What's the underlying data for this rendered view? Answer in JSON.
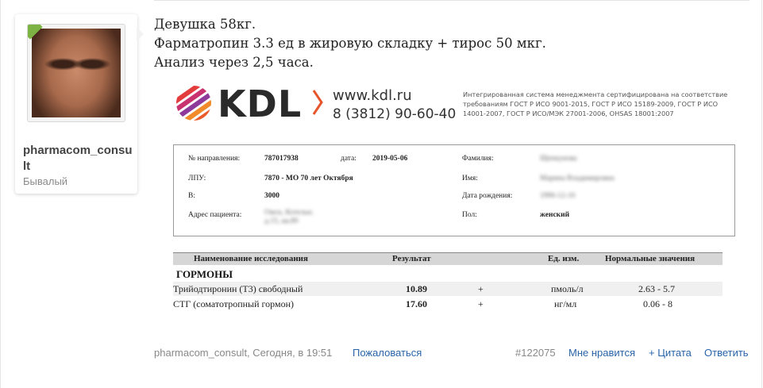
{
  "author": {
    "name": "pharmacom_consult",
    "rank": "Бывалый"
  },
  "message": {
    "lines": [
      "Девушка 58кг.",
      "Фарматропин 3.3 ед в жировую складку + тирос 50 мкг.",
      "Анализ через 2,5 часа."
    ]
  },
  "report": {
    "logo_text": "KDL",
    "site": "www.kdl.ru",
    "phone": "8 (3812) 90-60-40",
    "cert_text": "Интегрированная система менеджмента сертифицирована на соответствие требованиям ГОСТ Р ИСО 9001-2015, ГОСТ Р ИСО 15189-2009, ГОСТ Р ИСО 14001-2007, ГОСТ Р ИСО/МЭК 27001-2006, OHSAS 18001:2007",
    "info": {
      "referral_label": "№ направления:",
      "referral_value": "787017938",
      "date_label": "дата:",
      "date_value": "2019-05-06",
      "lpu_label": "ЛПУ:",
      "lpu_value": "7870 - МО 70 лет Октября",
      "b_label": "В:",
      "b_value": "3000",
      "address_label": "Адрес пациента:",
      "address_value": "Омск, Котельн. д.15, кв.89",
      "surname_label": "Фамилия:",
      "surname_value": "Щепкунова",
      "name_label": "Имя:",
      "name_value": "Марина Владимировна",
      "birth_label": "Дата рождения:",
      "birth_value": "1990-12-10",
      "sex_label": "Пол:",
      "sex_value": "женский"
    },
    "table": {
      "headers": [
        "Наименование исследования",
        "Результат",
        "Ед. изм.",
        "Нормальные значения"
      ],
      "section": "ГОРМОНЫ",
      "rows": [
        {
          "name": "Трийодтиронин (Т3) свободный",
          "result": "10.89",
          "flag": "+",
          "unit": "пмоль/л",
          "range": "2.63 - 5.7"
        },
        {
          "name": "СТГ (соматотропный гормон)",
          "result": "17.60",
          "flag": "+",
          "unit": "нг/мл",
          "range": "0.06 - 8"
        }
      ]
    }
  },
  "footer": {
    "meta": "pharmacom_consult, Сегодня, в 19:51",
    "report": "Пожаловаться",
    "post_number": "#122075",
    "like": "Мне нравится",
    "quote": "+ Цитата",
    "reply": "Ответить"
  }
}
